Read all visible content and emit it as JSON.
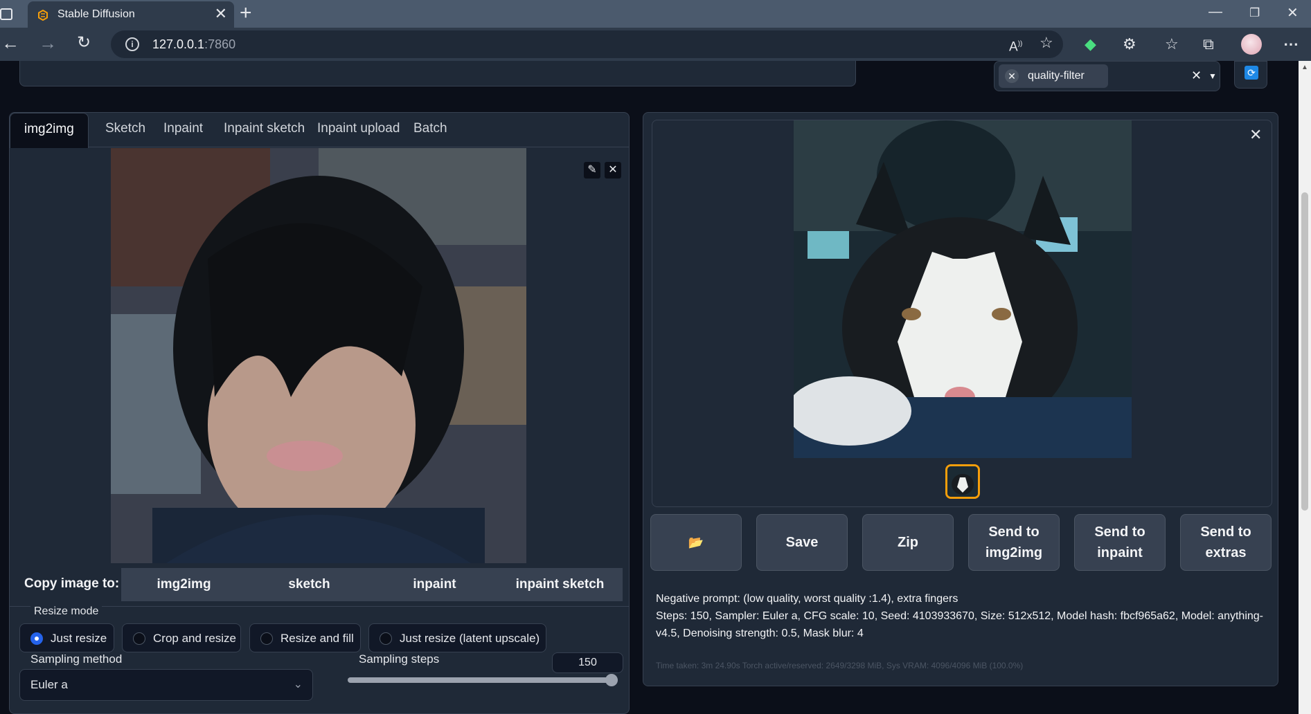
{
  "browser": {
    "tab_title": "Stable Diffusion",
    "url_host": "127.0.0.1",
    "url_port": ":7860"
  },
  "top": {
    "filter_chip": "quality-filter"
  },
  "left": {
    "tabs": [
      "img2img",
      "Sketch",
      "Inpaint",
      "Inpaint sketch",
      "Inpaint upload",
      "Batch"
    ],
    "active_tab": "img2img",
    "copy_label": "Copy image to:",
    "copy_buttons": [
      "img2img",
      "sketch",
      "inpaint",
      "inpaint sketch"
    ],
    "resize_mode_label": "Resize mode",
    "resize_modes": [
      "Just resize",
      "Crop and resize",
      "Resize and fill",
      "Just resize (latent upscale)"
    ],
    "resize_selected": "Just resize",
    "sampling_method_label": "Sampling method",
    "sampling_method": "Euler a",
    "sampling_steps_label": "Sampling steps",
    "sampling_steps": "150",
    "sampling_steps_fraction": 1.0
  },
  "right": {
    "buttons": [
      "📂",
      "Save",
      "Zip",
      "Send to\nimg2img",
      "Send to\ninpaint",
      "Send to\nextras"
    ],
    "negative_prompt": "Negative prompt: (low quality, worst quality :1.4), extra fingers",
    "params": "Steps: 150, Sampler: Euler a, CFG scale: 10, Seed: 4103933670, Size: 512x512, Model hash: fbcf965a62, Model: anything-v4.5, Denoising strength: 0.5, Mask blur: 4",
    "time_taken": "Time taken: 3m 24.90s  Torch active/reserved: 2649/3298 MiB, Sys VRAM: 4096/4096 MiB (100.0%)"
  }
}
